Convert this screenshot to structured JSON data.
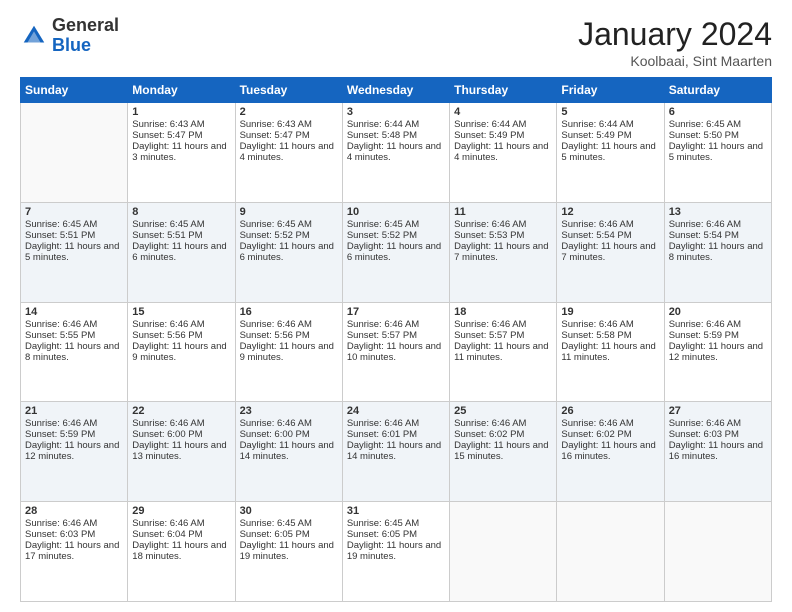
{
  "logo": {
    "general": "General",
    "blue": "Blue"
  },
  "header": {
    "month": "January 2024",
    "location": "Koolbaai, Sint Maarten"
  },
  "weekdays": [
    "Sunday",
    "Monday",
    "Tuesday",
    "Wednesday",
    "Thursday",
    "Friday",
    "Saturday"
  ],
  "weeks": [
    [
      {
        "day": "",
        "sunrise": "",
        "sunset": "",
        "daylight": ""
      },
      {
        "day": "1",
        "sunrise": "Sunrise: 6:43 AM",
        "sunset": "Sunset: 5:47 PM",
        "daylight": "Daylight: 11 hours and 3 minutes."
      },
      {
        "day": "2",
        "sunrise": "Sunrise: 6:43 AM",
        "sunset": "Sunset: 5:47 PM",
        "daylight": "Daylight: 11 hours and 4 minutes."
      },
      {
        "day": "3",
        "sunrise": "Sunrise: 6:44 AM",
        "sunset": "Sunset: 5:48 PM",
        "daylight": "Daylight: 11 hours and 4 minutes."
      },
      {
        "day": "4",
        "sunrise": "Sunrise: 6:44 AM",
        "sunset": "Sunset: 5:49 PM",
        "daylight": "Daylight: 11 hours and 4 minutes."
      },
      {
        "day": "5",
        "sunrise": "Sunrise: 6:44 AM",
        "sunset": "Sunset: 5:49 PM",
        "daylight": "Daylight: 11 hours and 5 minutes."
      },
      {
        "day": "6",
        "sunrise": "Sunrise: 6:45 AM",
        "sunset": "Sunset: 5:50 PM",
        "daylight": "Daylight: 11 hours and 5 minutes."
      }
    ],
    [
      {
        "day": "7",
        "sunrise": "Sunrise: 6:45 AM",
        "sunset": "Sunset: 5:51 PM",
        "daylight": "Daylight: 11 hours and 5 minutes."
      },
      {
        "day": "8",
        "sunrise": "Sunrise: 6:45 AM",
        "sunset": "Sunset: 5:51 PM",
        "daylight": "Daylight: 11 hours and 6 minutes."
      },
      {
        "day": "9",
        "sunrise": "Sunrise: 6:45 AM",
        "sunset": "Sunset: 5:52 PM",
        "daylight": "Daylight: 11 hours and 6 minutes."
      },
      {
        "day": "10",
        "sunrise": "Sunrise: 6:45 AM",
        "sunset": "Sunset: 5:52 PM",
        "daylight": "Daylight: 11 hours and 6 minutes."
      },
      {
        "day": "11",
        "sunrise": "Sunrise: 6:46 AM",
        "sunset": "Sunset: 5:53 PM",
        "daylight": "Daylight: 11 hours and 7 minutes."
      },
      {
        "day": "12",
        "sunrise": "Sunrise: 6:46 AM",
        "sunset": "Sunset: 5:54 PM",
        "daylight": "Daylight: 11 hours and 7 minutes."
      },
      {
        "day": "13",
        "sunrise": "Sunrise: 6:46 AM",
        "sunset": "Sunset: 5:54 PM",
        "daylight": "Daylight: 11 hours and 8 minutes."
      }
    ],
    [
      {
        "day": "14",
        "sunrise": "Sunrise: 6:46 AM",
        "sunset": "Sunset: 5:55 PM",
        "daylight": "Daylight: 11 hours and 8 minutes."
      },
      {
        "day": "15",
        "sunrise": "Sunrise: 6:46 AM",
        "sunset": "Sunset: 5:56 PM",
        "daylight": "Daylight: 11 hours and 9 minutes."
      },
      {
        "day": "16",
        "sunrise": "Sunrise: 6:46 AM",
        "sunset": "Sunset: 5:56 PM",
        "daylight": "Daylight: 11 hours and 9 minutes."
      },
      {
        "day": "17",
        "sunrise": "Sunrise: 6:46 AM",
        "sunset": "Sunset: 5:57 PM",
        "daylight": "Daylight: 11 hours and 10 minutes."
      },
      {
        "day": "18",
        "sunrise": "Sunrise: 6:46 AM",
        "sunset": "Sunset: 5:57 PM",
        "daylight": "Daylight: 11 hours and 11 minutes."
      },
      {
        "day": "19",
        "sunrise": "Sunrise: 6:46 AM",
        "sunset": "Sunset: 5:58 PM",
        "daylight": "Daylight: 11 hours and 11 minutes."
      },
      {
        "day": "20",
        "sunrise": "Sunrise: 6:46 AM",
        "sunset": "Sunset: 5:59 PM",
        "daylight": "Daylight: 11 hours and 12 minutes."
      }
    ],
    [
      {
        "day": "21",
        "sunrise": "Sunrise: 6:46 AM",
        "sunset": "Sunset: 5:59 PM",
        "daylight": "Daylight: 11 hours and 12 minutes."
      },
      {
        "day": "22",
        "sunrise": "Sunrise: 6:46 AM",
        "sunset": "Sunset: 6:00 PM",
        "daylight": "Daylight: 11 hours and 13 minutes."
      },
      {
        "day": "23",
        "sunrise": "Sunrise: 6:46 AM",
        "sunset": "Sunset: 6:00 PM",
        "daylight": "Daylight: 11 hours and 14 minutes."
      },
      {
        "day": "24",
        "sunrise": "Sunrise: 6:46 AM",
        "sunset": "Sunset: 6:01 PM",
        "daylight": "Daylight: 11 hours and 14 minutes."
      },
      {
        "day": "25",
        "sunrise": "Sunrise: 6:46 AM",
        "sunset": "Sunset: 6:02 PM",
        "daylight": "Daylight: 11 hours and 15 minutes."
      },
      {
        "day": "26",
        "sunrise": "Sunrise: 6:46 AM",
        "sunset": "Sunset: 6:02 PM",
        "daylight": "Daylight: 11 hours and 16 minutes."
      },
      {
        "day": "27",
        "sunrise": "Sunrise: 6:46 AM",
        "sunset": "Sunset: 6:03 PM",
        "daylight": "Daylight: 11 hours and 16 minutes."
      }
    ],
    [
      {
        "day": "28",
        "sunrise": "Sunrise: 6:46 AM",
        "sunset": "Sunset: 6:03 PM",
        "daylight": "Daylight: 11 hours and 17 minutes."
      },
      {
        "day": "29",
        "sunrise": "Sunrise: 6:46 AM",
        "sunset": "Sunset: 6:04 PM",
        "daylight": "Daylight: 11 hours and 18 minutes."
      },
      {
        "day": "30",
        "sunrise": "Sunrise: 6:45 AM",
        "sunset": "Sunset: 6:05 PM",
        "daylight": "Daylight: 11 hours and 19 minutes."
      },
      {
        "day": "31",
        "sunrise": "Sunrise: 6:45 AM",
        "sunset": "Sunset: 6:05 PM",
        "daylight": "Daylight: 11 hours and 19 minutes."
      },
      {
        "day": "",
        "sunrise": "",
        "sunset": "",
        "daylight": ""
      },
      {
        "day": "",
        "sunrise": "",
        "sunset": "",
        "daylight": ""
      },
      {
        "day": "",
        "sunrise": "",
        "sunset": "",
        "daylight": ""
      }
    ]
  ]
}
